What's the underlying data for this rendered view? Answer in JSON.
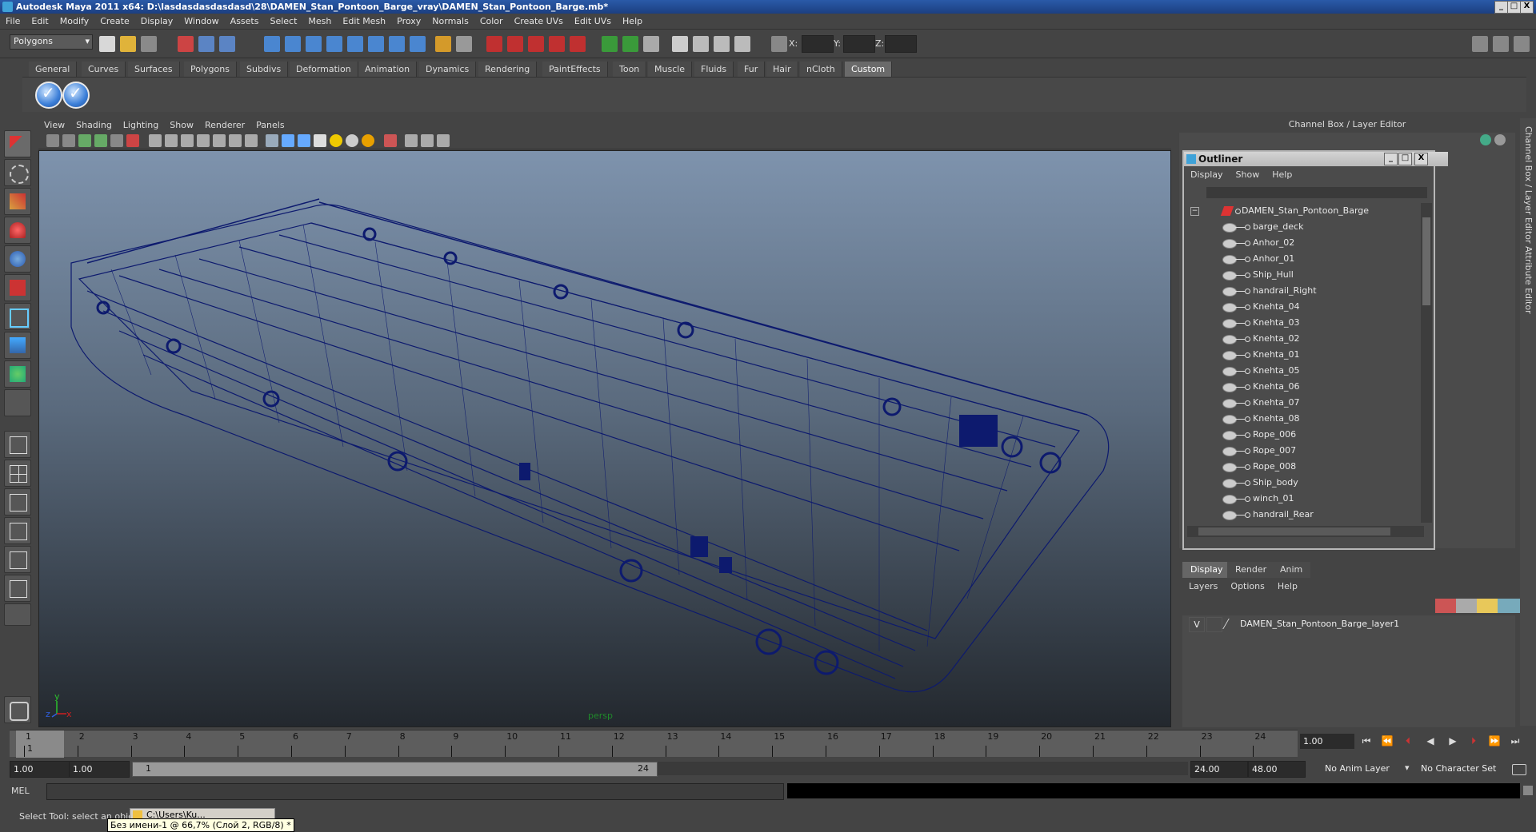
{
  "window": {
    "title": "Autodesk Maya 2011 x64: D:\\lasdasdasdasdasd\\28\\DAMEN_Stan_Pontoon_Barge_vray\\DAMEN_Stan_Pontoon_Barge.mb*",
    "minimize": "_",
    "maximize": "□",
    "close": "X"
  },
  "menubar": [
    "File",
    "Edit",
    "Modify",
    "Create",
    "Display",
    "Window",
    "Assets",
    "Select",
    "Mesh",
    "Edit Mesh",
    "Proxy",
    "Normals",
    "Color",
    "Create UVs",
    "Edit UVs",
    "Help"
  ],
  "statusline": {
    "mode": "Polygons",
    "x_label": "X:",
    "y_label": "Y:",
    "z_label": "Z:"
  },
  "shelf": {
    "tabs": [
      "General",
      "Curves",
      "Surfaces",
      "Polygons",
      "Subdivs",
      "Deformation",
      "Animation",
      "Dynamics",
      "Rendering",
      "PaintEffects",
      "Toon",
      "Muscle",
      "Fluids",
      "Fur",
      "Hair",
      "nCloth",
      "Custom"
    ],
    "active_tab": "Custom"
  },
  "viewport": {
    "menu": [
      "View",
      "Shading",
      "Lighting",
      "Show",
      "Renderer",
      "Panels"
    ],
    "camera_label": "persp",
    "axis_y": "y",
    "axis_x": "x",
    "axis_z": "z"
  },
  "channel_box": {
    "title": "Channel Box / Layer Editor",
    "side_tab_1": "Channel Box / Layer Editor",
    "side_tab_2": "Attribute Editor"
  },
  "outliner": {
    "title": "Outliner",
    "menu": [
      "Display",
      "Show",
      "Help"
    ],
    "root": "DAMEN_Stan_Pontoon_Barge",
    "expander": "−",
    "items": [
      "barge_deck",
      "Anhor_02",
      "Anhor_01",
      "Ship_Hull",
      "handrail_Right",
      "Knehta_04",
      "Knehta_03",
      "Knehta_02",
      "Knehta_01",
      "Knehta_05",
      "Knehta_06",
      "Knehta_07",
      "Knehta_08",
      "Rope_006",
      "Rope_007",
      "Rope_008",
      "Ship_body",
      "winch_01",
      "handrail_Rear"
    ]
  },
  "layer_editor": {
    "tabs": [
      "Display",
      "Render",
      "Anim"
    ],
    "active_tab": "Display",
    "menu": [
      "Layers",
      "Options",
      "Help"
    ],
    "layer_visibility": "V",
    "layer_name": "DAMEN_Stan_Pontoon_Barge_layer1"
  },
  "timeline": {
    "ticks": [
      "1",
      "2",
      "3",
      "4",
      "5",
      "6",
      "7",
      "8",
      "9",
      "10",
      "11",
      "12",
      "13",
      "14",
      "15",
      "16",
      "17",
      "18",
      "19",
      "20",
      "21",
      "22",
      "23",
      "24"
    ],
    "current_marker": "1",
    "current_frame": "1.00"
  },
  "range": {
    "start": "1.00",
    "playback_start": "1.00",
    "slider_start": "1",
    "slider_end": "24",
    "playback_end": "24.00",
    "end": "48.00",
    "anim_layer": "No Anim Layer",
    "character_set": "No Character Set"
  },
  "command_line": {
    "label": "MEL"
  },
  "help_line": {
    "text": "Select Tool: select an object",
    "task_button": "C:\\Users\\Ku...",
    "tooltip": "Без имени-1 @ 66,7% (Слой 2, RGB/8) *"
  },
  "colors": {
    "wireframe": "#0d1a6e",
    "title_bar": "#2a5aa8",
    "persp_label": "#1f8a2a"
  }
}
